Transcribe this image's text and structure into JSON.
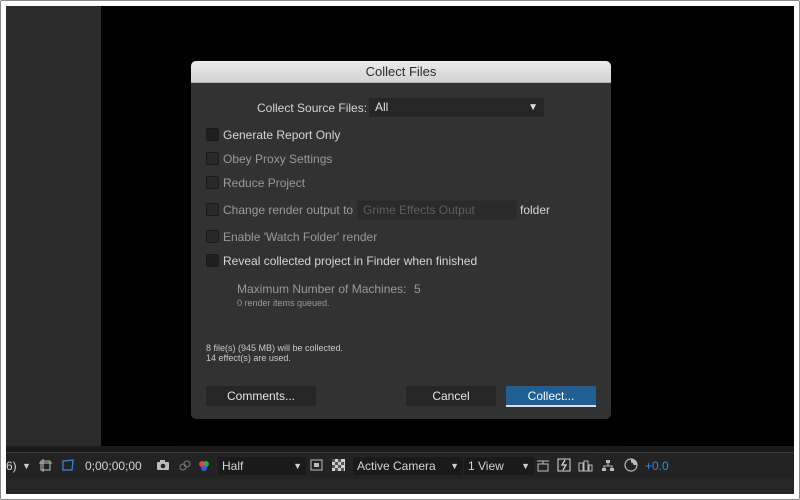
{
  "dialog": {
    "title": "Collect Files",
    "source_label": "Collect Source Files:",
    "source_value": "All",
    "options": [
      {
        "label": "Generate Report Only",
        "checked": false,
        "enabled": true
      },
      {
        "label": "Obey Proxy Settings",
        "checked": false,
        "enabled": false
      },
      {
        "label": "Reduce Project",
        "checked": false,
        "enabled": false
      },
      {
        "label": "Change render output to",
        "checked": false,
        "enabled": false
      },
      {
        "label": "Enable 'Watch Folder' render",
        "checked": false,
        "enabled": false
      },
      {
        "label": "Reveal collected project in Finder when finished",
        "checked": false,
        "enabled": true
      }
    ],
    "render_output_value": "Grime Effects Output",
    "folder_label": "folder",
    "max_machines_label": "Maximum Number of Machines:",
    "max_machines_value": "5",
    "queued_text": "0 render items queued.",
    "summary_files": "8 file(s) (945 MB) will be collected.",
    "summary_effects": "14 effect(s) are used.",
    "buttons": {
      "comments": "Comments...",
      "cancel": "Cancel",
      "collect": "Collect..."
    }
  },
  "toolbar": {
    "magnification_partial": "6)",
    "timecode": "0;00;00;00",
    "resolution": "Half",
    "camera": "Active Camera",
    "views": "1 View",
    "exposure": "+0.0"
  },
  "colors": {
    "accent_blue": "#2d8ceb",
    "primary_button": "#1f5f93",
    "dialog_bg": "#323232"
  }
}
